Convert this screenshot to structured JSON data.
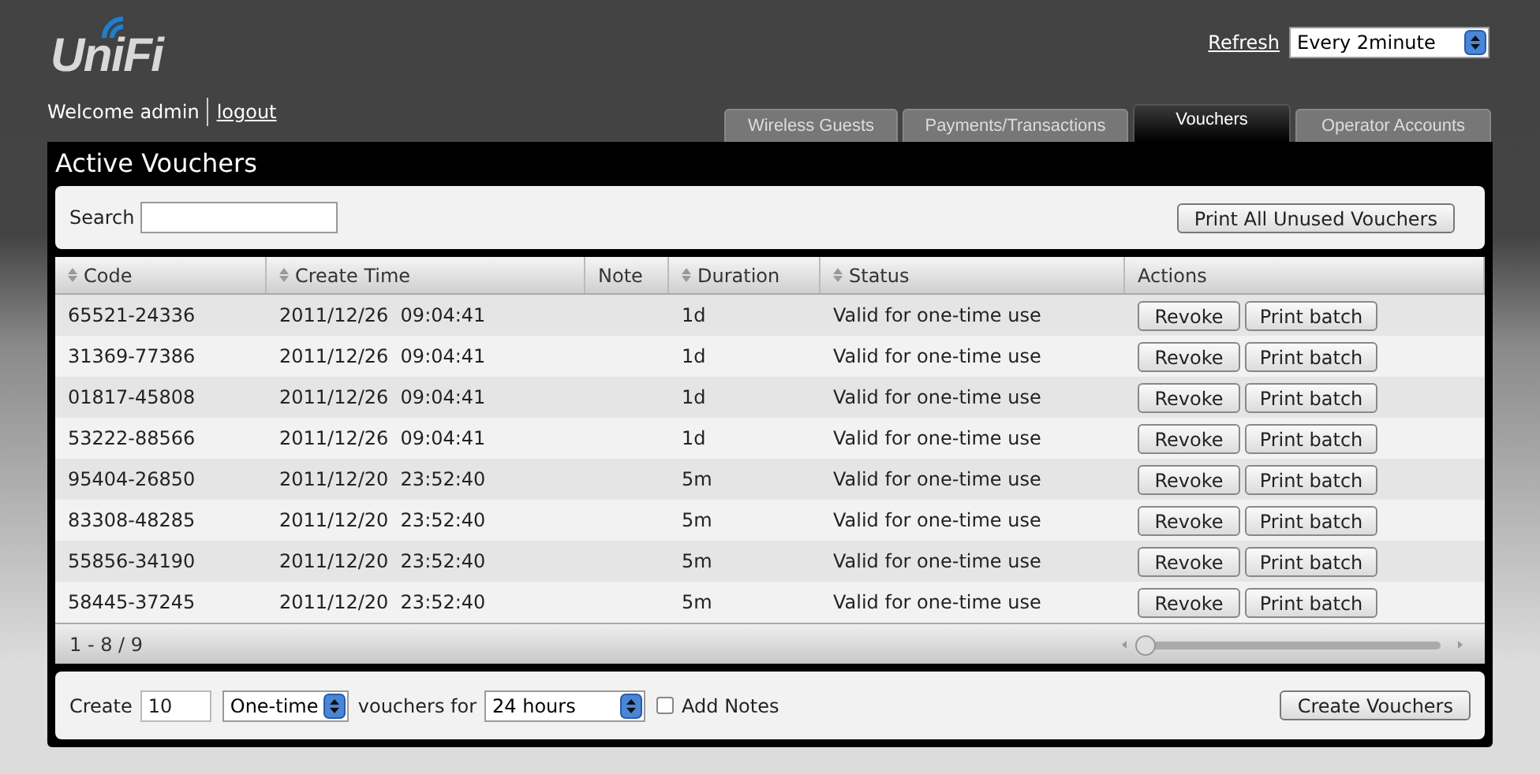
{
  "header": {
    "logo": "UniFi",
    "welcome": "Welcome admin",
    "logout": "logout",
    "refresh_link": "Refresh",
    "refresh_select": "Every 2minute"
  },
  "tabs": [
    {
      "label": "Wireless Guests",
      "selected": false
    },
    {
      "label": "Payments/Transactions",
      "selected": false
    },
    {
      "label": "Vouchers",
      "selected": true
    },
    {
      "label": "Operator Accounts",
      "selected": false
    }
  ],
  "panel": {
    "title": "Active Vouchers",
    "search": {
      "label": "Search"
    },
    "print_all_button": "Print All Unused Vouchers"
  },
  "table": {
    "columns": [
      {
        "label": "Code",
        "sortable": true
      },
      {
        "label": "Create Time",
        "sortable": true
      },
      {
        "label": "Note",
        "sortable": false
      },
      {
        "label": "Duration",
        "sortable": true
      },
      {
        "label": "Status",
        "sortable": true
      },
      {
        "label": "Actions",
        "sortable": false
      }
    ],
    "rows": [
      {
        "code": "65521-24336",
        "create_time": "2011/12/26  09:04:41",
        "duration": "1d",
        "status": "Valid for one-time use",
        "actions": [
          "Revoke",
          "Print batch"
        ]
      },
      {
        "code": "31369-77386",
        "create_time": "2011/12/26  09:04:41",
        "duration": "1d",
        "status": "Valid for one-time use",
        "actions": [
          "Revoke",
          "Print batch"
        ]
      },
      {
        "code": "01817-45808",
        "create_time": "2011/12/26  09:04:41",
        "duration": "1d",
        "status": "Valid for one-time use",
        "actions": [
          "Revoke",
          "Print batch"
        ]
      },
      {
        "code": "53222-88566",
        "create_time": "2011/12/26  09:04:41",
        "duration": "1d",
        "status": "Valid for one-time use",
        "actions": [
          "Revoke",
          "Print batch"
        ]
      },
      {
        "code": "95404-26850",
        "create_time": "2011/12/20  23:52:40",
        "duration": "5m",
        "status": "Valid for one-time use",
        "actions": [
          "Revoke",
          "Print batch"
        ]
      },
      {
        "code": "83308-48285",
        "create_time": "2011/12/20  23:52:40",
        "duration": "5m",
        "status": "Valid for one-time use",
        "actions": [
          "Revoke",
          "Print batch"
        ]
      },
      {
        "code": "55856-34190",
        "create_time": "2011/12/20  23:52:40",
        "duration": "5m",
        "status": "Valid for one-time use",
        "actions": [
          "Revoke",
          "Print batch"
        ]
      },
      {
        "code": "58445-37245",
        "create_time": "2011/12/20  23:52:40",
        "duration": "5m",
        "status": "Valid for one-time use",
        "actions": [
          "Revoke",
          "Print batch"
        ]
      }
    ],
    "pager": "1 - 8 / 9"
  },
  "create": {
    "label": "Create",
    "count": "10",
    "type_select": "One-time",
    "for_label": "vouchers for",
    "duration_select": "24 hours",
    "add_notes": {
      "label": "Add Notes",
      "checked": false
    },
    "button": "Create Vouchers"
  }
}
